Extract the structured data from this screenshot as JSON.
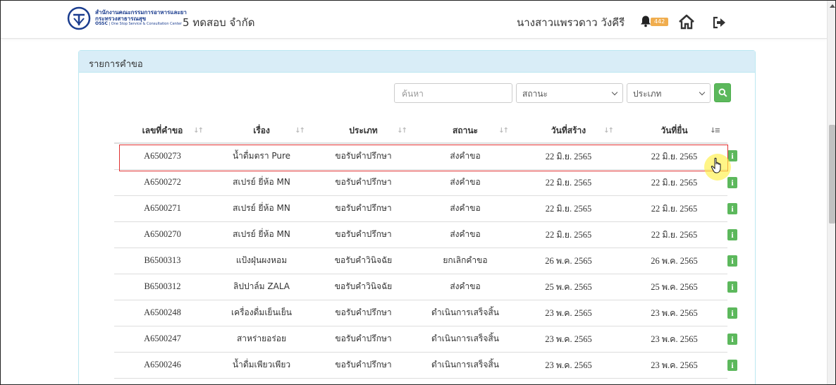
{
  "header": {
    "logo_line1": "สำนักงานคณะกรรมการอาหารและยา",
    "logo_line2": "กระทรวงสาธารณสุข",
    "logo_line3_bold": "OSSC",
    "logo_line3_rest": " | One Stop Service & Consultation Center",
    "company": "5 ทดสอบ จำกัด",
    "user_name": "นางสาวแพรวดาว วังคีรี",
    "notification_count": "442",
    "icons": [
      "bell-icon",
      "home-icon",
      "logout-icon"
    ]
  },
  "panel": {
    "title": "รายการคำขอ"
  },
  "filters": {
    "search_placeholder": "ค้นหา",
    "status_selected": "สถานะ",
    "type_selected": "ประเภท"
  },
  "table": {
    "headers": [
      "เลขที่คำขอ",
      "เรื่อง",
      "ประเภท",
      "สถานะ",
      "วันที่สร้าง",
      "วันที่ยื่น"
    ],
    "rows": [
      {
        "id": "A6500273",
        "subject": "น้ำดื่มตรา Pure",
        "type": "ขอรับคำปรึกษา",
        "status": "ส่งคำขอ",
        "created": "22 มิ.ย. 2565",
        "submitted": "22 มิ.ย. 2565"
      },
      {
        "id": "A6500272",
        "subject": "สเปรย์ ยี่ห้อ MN",
        "type": "ขอรับคำปรึกษา",
        "status": "ส่งคำขอ",
        "created": "22 มิ.ย. 2565",
        "submitted": "22 มิ.ย. 2565"
      },
      {
        "id": "A6500271",
        "subject": "สเปรย์ ยี่ห้อ MN",
        "type": "ขอรับคำปรึกษา",
        "status": "ส่งคำขอ",
        "created": "22 มิ.ย. 2565",
        "submitted": "22 มิ.ย. 2565"
      },
      {
        "id": "A6500270",
        "subject": "สเปรย์ ยี่ห้อ MN",
        "type": "ขอรับคำปรึกษา",
        "status": "ส่งคำขอ",
        "created": "22 มิ.ย. 2565",
        "submitted": "22 มิ.ย. 2565"
      },
      {
        "id": "B6500313",
        "subject": "แป้งฝุ่นผงหอม",
        "type": "ขอรับคำวินิจฉัย",
        "status": "ยกเลิกคำขอ",
        "created": "26 พ.ค. 2565",
        "submitted": "26 พ.ค. 2565"
      },
      {
        "id": "B6500312",
        "subject": "ลิปปาล์ม ZALA",
        "type": "ขอรับคำวินิจฉัย",
        "status": "ส่งคำขอ",
        "created": "25 พ.ค. 2565",
        "submitted": "25 พ.ค. 2565"
      },
      {
        "id": "A6500248",
        "subject": "เครื่องดื่มเย็นเย็น",
        "type": "ขอรับคำปรึกษา",
        "status": "ดำเนินการเสร็จสิ้น",
        "created": "23 พ.ค. 2565",
        "submitted": "23 พ.ค. 2565"
      },
      {
        "id": "A6500247",
        "subject": "สาหร่ายอร่อย",
        "type": "ขอรับคำปรึกษา",
        "status": "ดำเนินการเสร็จสิ้น",
        "created": "23 พ.ค. 2565",
        "submitted": "23 พ.ค. 2565"
      },
      {
        "id": "A6500246",
        "subject": "น้ำดื่มเพียวเพียว",
        "type": "ขอรับคำปรึกษา",
        "status": "ดำเนินการเสร็จสิ้น",
        "created": "23 พ.ค. 2565",
        "submitted": "23 พ.ค. 2565"
      }
    ],
    "info_label": "i"
  },
  "colors": {
    "panel_header_bg": "#d9edf7",
    "action_green": "#5cb85c",
    "badge_orange": "#f0ad4e",
    "highlight_red": "#e03131",
    "brand_blue": "#1b3d8f"
  }
}
